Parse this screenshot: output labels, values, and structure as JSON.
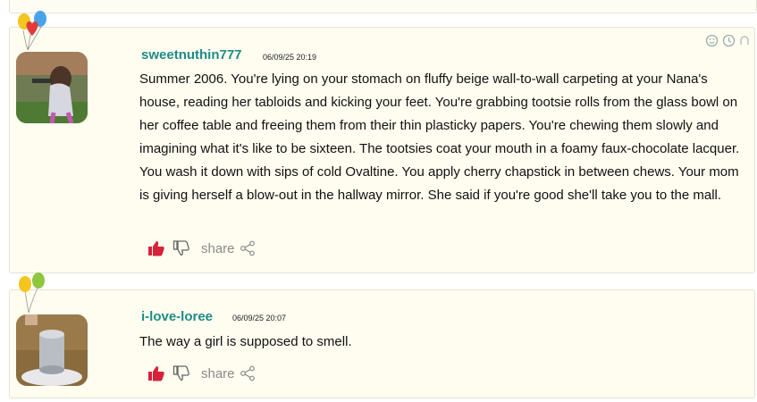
{
  "comments": [
    {
      "username": "sweetnuthin777",
      "timestamp": "06/09/25 20:19",
      "text": "Summer 2006. You're lying on your stomach on fluffy beige wall-to-wall carpeting at your Nana's house, reading her tabloids and kicking your feet. You're grabbing tootsie rolls from the glass bowl on her coffee table and freeing them from their thin plasticky papers. You're chewing them slowly and imagining what it's like to be sixteen. The tootsies coat your mouth in a foamy faux-chocolate lacquer. You wash it down with sips of cold Ovaltine. You apply cherry chapstick in between chews. Your mom is giving herself a blow-out in the hallway mirror. She said if you're good she'll take you to the mall.",
      "share_label": "share",
      "badge_icon": "balloons-icon",
      "avatar_icon": "avatar-girl-outdoors"
    },
    {
      "username": "i-love-loree",
      "timestamp": "06/09/25 20:07",
      "text": "The way a girl is supposed to smell.",
      "share_label": "share",
      "badge_icon": "balloons-icon",
      "avatar_icon": "avatar-paint-can"
    }
  ],
  "top_icons": [
    "smile-icon",
    "clock-icon",
    "info-icon"
  ],
  "colors": {
    "username": "#1e8c86",
    "like": "#d8213a",
    "card_background": "#fefdf0",
    "share": "#8a8a8a"
  }
}
